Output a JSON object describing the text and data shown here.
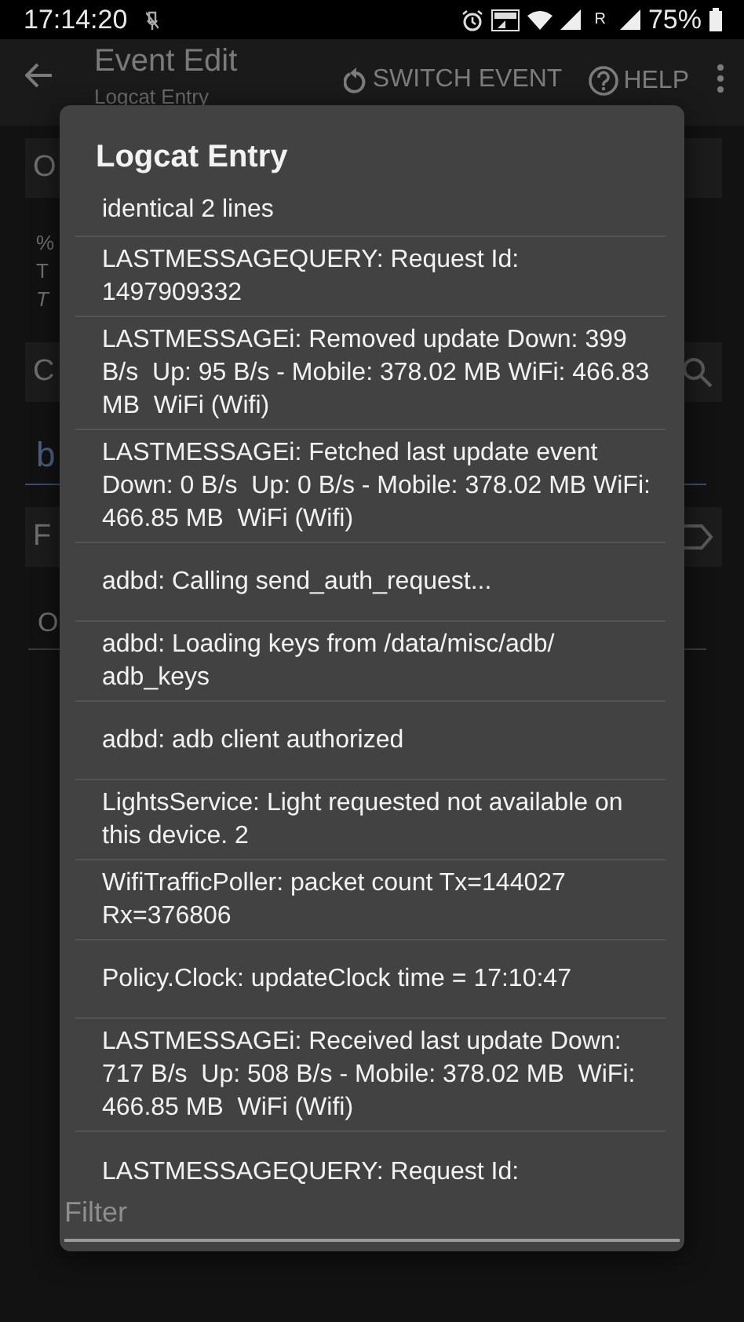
{
  "status_bar": {
    "time": "17:14:20",
    "roaming": "R",
    "battery": "75%"
  },
  "app_bar": {
    "title": "Event Edit",
    "subtitle": "Logcat Entry",
    "actions": [
      {
        "kind": "switch",
        "label": "SWITCH EVENT"
      },
      {
        "kind": "help",
        "label": "HELP"
      }
    ]
  },
  "background": [
    {
      "kind": "card",
      "text": "O"
    },
    {
      "kind": "text",
      "text": "%"
    },
    {
      "kind": "text",
      "text": "T"
    },
    {
      "kind": "italic",
      "text": "T"
    },
    {
      "kind": "search",
      "text": "C"
    },
    {
      "kind": "input",
      "text": "b"
    },
    {
      "kind": "tag",
      "text": "F"
    },
    {
      "kind": "line",
      "text": "O"
    }
  ],
  "dialog": {
    "title": "Logcat Entry",
    "entries": [
      "identical 2 lines",
      "LASTMESSAGEQUERY: Request Id: 1497909332",
      "LASTMESSAGEi: Removed update Down: 399 B/s  Up: 95 B/s - Mobile: 378.02 MB WiFi: 466.83 MB  WiFi (Wifi)",
      "LASTMESSAGEi: Fetched last update event Down: 0 B/s  Up: 0 B/s - Mobile: 378.02 MB WiFi: 466.85 MB  WiFi (Wifi)",
      "adbd: Calling send_auth_request...",
      "adbd: Loading keys from /data/misc/adb/ adb_keys",
      "adbd: adb client authorized",
      "LightsService: Light requested not available on this device. 2",
      "WifiTrafficPoller: packet count Tx=144027 Rx=376806",
      "Policy.Clock: updateClock time = 17:10:47",
      "LASTMESSAGEi: Received last update Down: 717 B/s  Up: 508 B/s - Mobile: 378.02 MB  WiFi: 466.85 MB  WiFi (Wifi)",
      "LASTMESSAGEQUERY: Request Id:"
    ],
    "filter": {
      "placeholder": "Filter"
    }
  }
}
